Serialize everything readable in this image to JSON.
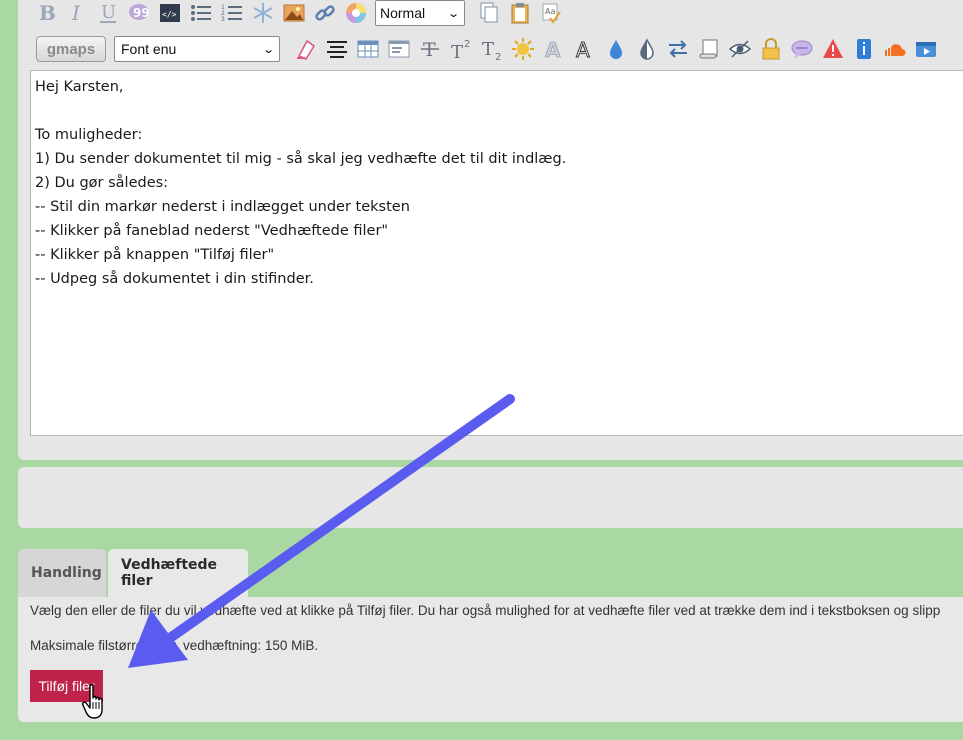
{
  "toolbar": {
    "row1_icons": [
      "bold-icon",
      "italic-icon",
      "underline-icon",
      "quote-icon",
      "code-icon",
      "bullet-list-icon",
      "numbered-list-icon",
      "asterisk-icon",
      "image-icon",
      "link-icon",
      "color-icon"
    ],
    "format_select": "Normal",
    "row1_tail_icons": [
      "copy-icon",
      "paste-icon",
      "spellcheck-icon"
    ],
    "gmaps_label": "gmaps",
    "font_select": "Font enu",
    "row2_icons": [
      "highlight-icon",
      "align-center-icon",
      "table-icon",
      "text-box-icon",
      "strikethrough-icon",
      "superscript-icon",
      "subscript-icon",
      "sun-icon",
      "outline-font-icon",
      "font-icon",
      "drop-icon",
      "contrast-icon",
      "swap-icon",
      "scroll-icon",
      "eye-icon",
      "lock-icon",
      "speech-bubble-icon",
      "warning-icon",
      "info-icon",
      "soundcloud-icon",
      "media-icon"
    ]
  },
  "editor": {
    "lines": [
      "Hej Karsten,",
      "",
      "To muligheder:",
      "1) Du sender dokumentet til mig - så skal jeg vedhæfte det til dit indlæg.",
      "2) Du gør således:",
      "-- Stil din markør nederst i indlægget under teksten",
      "-- Klikker på faneblad nederst \"Vedhæftede filer\"",
      "-- Klikker på knappen \"Tilføj filer\"",
      "-- Udpeg så dokumentet i din stifinder."
    ]
  },
  "tabs": {
    "handling": "Handling",
    "attachments": "Vedhæftede filer"
  },
  "attachments": {
    "description": "Vælg den eller de filer du vil vedhæfte ved at klikke på Tilføj filer. Du har også mulighed for at vedhæfte filer ved at trække dem ind i tekstboksen og slipp",
    "max_size": "Maksimale filstørrelse pr. vedhæftning: 150 MiB.",
    "add_button": "Tilføj filer"
  },
  "colors": {
    "page_bg": "#a9d8a3",
    "add_button_bg": "#c0234a",
    "annotation_arrow": "#5a5cf0"
  }
}
